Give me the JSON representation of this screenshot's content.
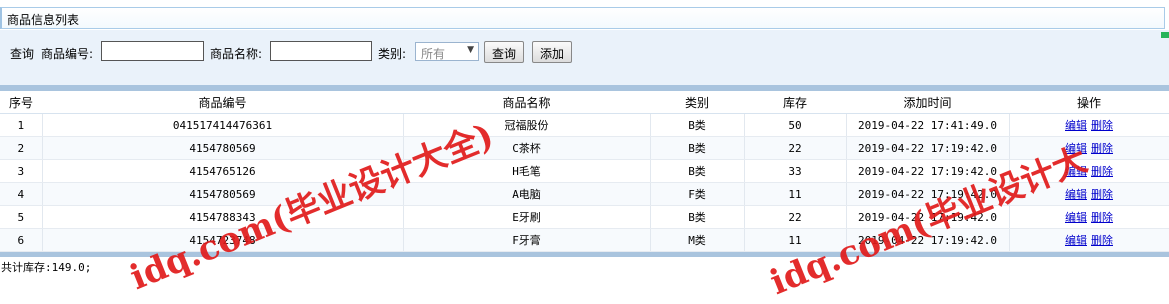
{
  "panel": {
    "title": "商品信息列表"
  },
  "search": {
    "query_label": "查询",
    "code_label": "商品编号:",
    "code_value": "",
    "name_label": "商品名称:",
    "name_value": "",
    "category_label": "类别:",
    "category_selected": "所有",
    "query_button": "查询",
    "add_button": "添加"
  },
  "table": {
    "headers": [
      "序号",
      "商品编号",
      "商品名称",
      "类别",
      "库存",
      "添加时间",
      "操作"
    ],
    "rows": [
      [
        "1",
        "041517414476361",
        "冠福股份",
        "B类",
        "50",
        "2019-04-22 17:41:49.0"
      ],
      [
        "2",
        "4154780569",
        "C茶杯",
        "B类",
        "22",
        "2019-04-22 17:19:42.0"
      ],
      [
        "3",
        "4154765126",
        "H毛笔",
        "B类",
        "33",
        "2019-04-22 17:19:42.0"
      ],
      [
        "4",
        "4154780569",
        "A电脑",
        "F类",
        "11",
        "2019-04-22 17:19:42.0"
      ],
      [
        "5",
        "4154788343",
        "E牙刷",
        "B类",
        "22",
        "2019-04-22 17:19:42.0"
      ],
      [
        "6",
        "4154723748",
        "F牙膏",
        "M类",
        "11",
        "2019-04-22 17:19:42.0"
      ]
    ],
    "edit_label": "编辑",
    "delete_label": "删除"
  },
  "footer": {
    "total_stock": "共计库存:149.0;"
  },
  "watermark": {
    "text_left": "idq.com(毕业设计大全)",
    "text_right": "idq.com(毕业设计大",
    "color": "#e11b1b"
  },
  "colors": {
    "accent_bar": "#a9c4de",
    "link": "#0000cc",
    "corner": "#27b35a"
  }
}
